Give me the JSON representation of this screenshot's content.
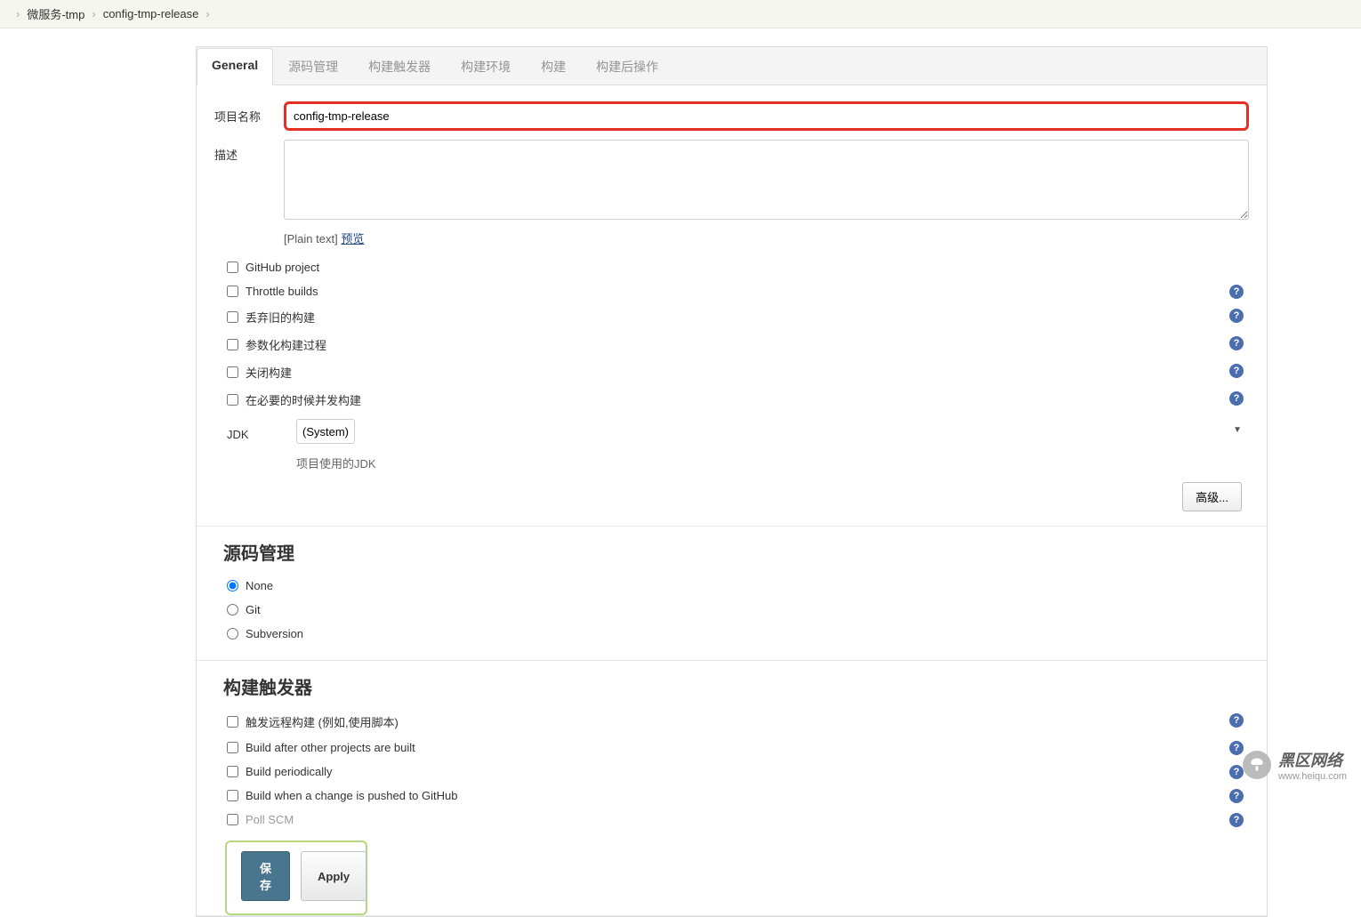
{
  "breadcrumb": {
    "item1": "微服务-tmp",
    "item2": "config-tmp-release"
  },
  "tabs": [
    "General",
    "源码管理",
    "构建触发器",
    "构建环境",
    "构建",
    "构建后操作"
  ],
  "form": {
    "project_name_label": "项目名称",
    "project_name_value": "config-tmp-release",
    "desc_label": "描述",
    "desc_value": "",
    "plain_text": "[Plain text]",
    "preview": "预览"
  },
  "checkboxes": [
    {
      "label": "GitHub project",
      "help": false
    },
    {
      "label": "Throttle builds",
      "help": true
    },
    {
      "label": "丢弃旧的构建",
      "help": true
    },
    {
      "label": "参数化构建过程",
      "help": true
    },
    {
      "label": "关闭构建",
      "help": true
    },
    {
      "label": "在必要的时候并发构建",
      "help": true
    }
  ],
  "jdk": {
    "label": "JDK",
    "value": "(System)",
    "hint": "项目使用的JDK"
  },
  "advanced_btn": "高级...",
  "sections": {
    "scm": "源码管理",
    "triggers": "构建触发器"
  },
  "scm_options": [
    "None",
    "Git",
    "Subversion"
  ],
  "scm_selected": 0,
  "triggers": [
    {
      "label": "触发远程构建 (例如,使用脚本)",
      "help": true
    },
    {
      "label": "Build after other projects are built",
      "help": true
    },
    {
      "label": "Build periodically",
      "help": true
    },
    {
      "label": "Build when a change is pushed to GitHub",
      "help": true
    },
    {
      "label": "Poll SCM",
      "help": true,
      "faded": true
    }
  ],
  "actions": {
    "save": "保存",
    "apply": "Apply"
  },
  "watermark": {
    "title": "黑区网络",
    "url": "www.heiqu.com"
  }
}
